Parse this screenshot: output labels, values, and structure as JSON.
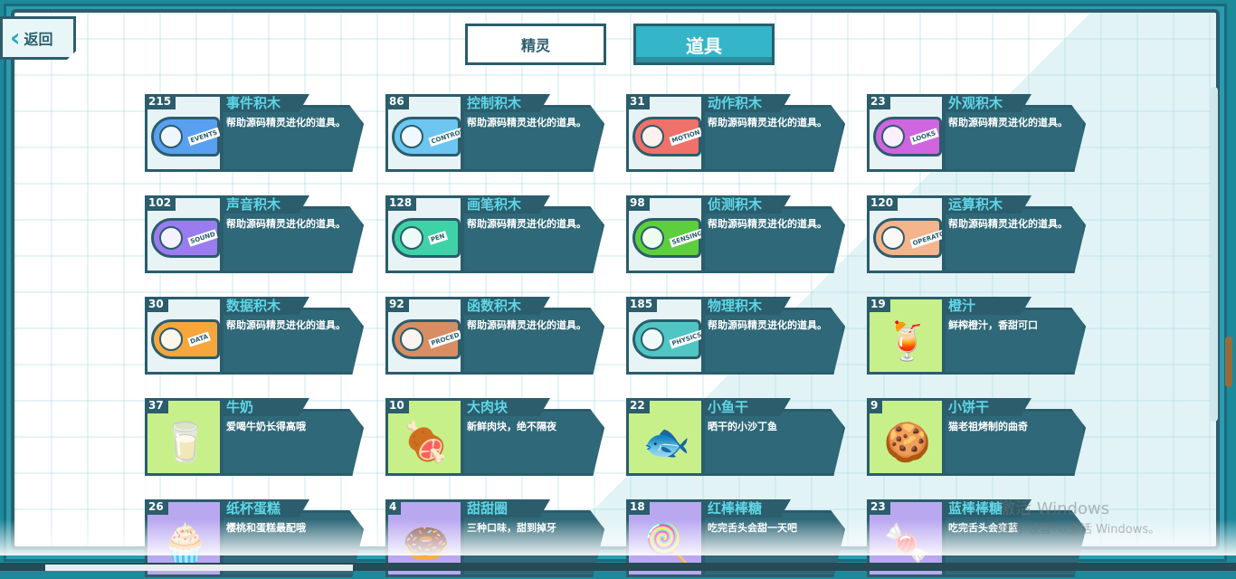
{
  "back_label": "返回",
  "tabs": [
    {
      "label": "精灵",
      "active": false
    },
    {
      "label": "道具",
      "active": true
    }
  ],
  "items": [
    {
      "count": "215",
      "name": "事件积木",
      "desc": "帮助源码精灵进化的道具。",
      "icon": "events-key-icon",
      "key_label": "EVENTS",
      "color": "#5aa0f0"
    },
    {
      "count": "86",
      "name": "控制积木",
      "desc": "帮助源码精灵进化的道具。",
      "icon": "control-key-icon",
      "key_label": "CONTROL",
      "color": "#6cc6f0"
    },
    {
      "count": "31",
      "name": "动作积木",
      "desc": "帮助源码精灵进化的道具。",
      "icon": "motion-key-icon",
      "key_label": "MOTION",
      "color": "#f0706a"
    },
    {
      "count": "23",
      "name": "外观积木",
      "desc": "帮助源码精灵进化的道具。",
      "icon": "looks-key-icon",
      "key_label": "LOOKS",
      "color": "#d065e0"
    },
    {
      "count": "102",
      "name": "声音积木",
      "desc": "帮助源码精灵进化的道具。",
      "icon": "sound-key-icon",
      "key_label": "SOUND",
      "color": "#9a7cf0"
    },
    {
      "count": "128",
      "name": "画笔积木",
      "desc": "帮助源码精灵进化的道具。",
      "icon": "pen-key-icon",
      "key_label": "PEN",
      "color": "#3fd2a6"
    },
    {
      "count": "98",
      "name": "侦测积木",
      "desc": "帮助源码精灵进化的道具。",
      "icon": "sensing-key-icon",
      "key_label": "SENSING",
      "color": "#5dcf3c"
    },
    {
      "count": "120",
      "name": "运算积木",
      "desc": "帮助源码精灵进化的道具。",
      "icon": "operator-key-icon",
      "key_label": "OPERATOR",
      "color": "#f4b48c"
    },
    {
      "count": "30",
      "name": "数据积木",
      "desc": "帮助源码精灵进化的道具。",
      "icon": "data-key-icon",
      "key_label": "DATA",
      "color": "#f6a63a"
    },
    {
      "count": "92",
      "name": "函数积木",
      "desc": "帮助源码精灵进化的道具。",
      "icon": "procedure-key-icon",
      "key_label": "PROCED",
      "color": "#d88e62"
    },
    {
      "count": "185",
      "name": "物理积木",
      "desc": "帮助源码精灵进化的道具。",
      "icon": "physics-key-icon",
      "key_label": "PHYSICS",
      "color": "#4fc6c4"
    },
    {
      "count": "19",
      "name": "橙汁",
      "desc": "鲜榨橙汁，香甜可口",
      "icon": "orange-juice-icon",
      "glyph": "🍹",
      "color": "#c8f08a"
    },
    {
      "count": "37",
      "name": "牛奶",
      "desc": "爱喝牛奶长得高哦",
      "icon": "milk-carton-icon",
      "glyph": "🥛",
      "color": "#c8f08a"
    },
    {
      "count": "10",
      "name": "大肉块",
      "desc": "新鲜肉块，绝不隔夜",
      "icon": "meat-icon",
      "glyph": "🍖",
      "color": "#c8f08a"
    },
    {
      "count": "22",
      "name": "小鱼干",
      "desc": "晒干的小沙丁鱼",
      "icon": "dried-fish-icon",
      "glyph": "🐟",
      "color": "#c8f08a"
    },
    {
      "count": "9",
      "name": "小饼干",
      "desc": "猫老祖烤制的曲奇",
      "icon": "cookie-icon",
      "glyph": "🍪",
      "color": "#c8f08a"
    },
    {
      "count": "26",
      "name": "纸杯蛋糕",
      "desc": "樱桃和蛋糕最配哦",
      "icon": "cupcake-icon",
      "glyph": "🧁",
      "color": "#b9a8f0"
    },
    {
      "count": "4",
      "name": "甜甜圈",
      "desc": "三种口味，甜到掉牙",
      "icon": "donut-icon",
      "glyph": "🍩",
      "color": "#b9a8f0"
    },
    {
      "count": "18",
      "name": "红棒棒糖",
      "desc": "吃完舌头会甜一天吧",
      "icon": "red-lollipop-icon",
      "glyph": "🍭",
      "color": "#b9a8f0"
    },
    {
      "count": "23",
      "name": "蓝棒棒糖",
      "desc": "吃完舌头会变蓝",
      "icon": "blue-lollipop-icon",
      "glyph": "🍬",
      "color": "#b9a8f0"
    }
  ],
  "watermark": {
    "line1": "激活 Windows",
    "line2": "转到\"设置\"以激活 Windows。"
  }
}
